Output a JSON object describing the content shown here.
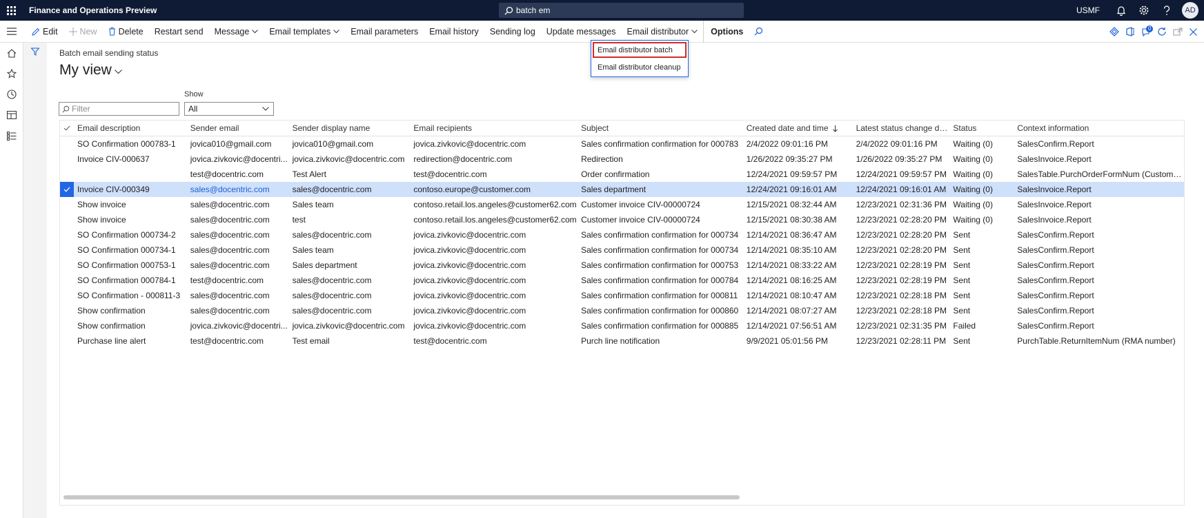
{
  "app": {
    "title": "Finance and Operations Preview",
    "search_value": "batch em",
    "company": "USMF",
    "avatar_initials": "AD"
  },
  "actions": {
    "edit": "Edit",
    "new": "New",
    "delete": "Delete",
    "restart_send": "Restart send",
    "message": "Message",
    "email_templates": "Email templates",
    "email_parameters": "Email parameters",
    "email_history": "Email history",
    "sending_log": "Sending log",
    "update_messages": "Update messages",
    "email_distributor": "Email distributor",
    "options": "Options",
    "notification_count": "0"
  },
  "dropdown": {
    "items": [
      "Email distributor batch",
      "Email distributor cleanup"
    ]
  },
  "page": {
    "caption": "Batch email sending status",
    "view_name": "My view",
    "filter_placeholder": "Filter",
    "show_label": "Show",
    "show_value": "All"
  },
  "grid": {
    "columns": [
      "Email description",
      "Sender email",
      "Sender display name",
      "Email recipients",
      "Subject",
      "Created date and time",
      "Latest status change dat...",
      "Status",
      "Context information"
    ],
    "rows": [
      [
        "SO Confirmation 000783-1",
        "jovica010@gmail.com",
        "jovica010@gmail.com",
        "jovica.zivkovic@docentric.com",
        "Sales confirmation confirmation for 000783",
        "2/4/2022 09:01:16 PM",
        "2/4/2022 09:01:16 PM",
        "Waiting (0)",
        "SalesConfirm.Report"
      ],
      [
        "Invoice CIV-000637",
        "jovica.zivkovic@docentri...",
        "jovica.zivkovic@docentric.com",
        "redirection@docentric.com",
        "Redirection",
        "1/26/2022 09:35:27 PM",
        "1/26/2022 09:35:27 PM",
        "Waiting (0)",
        "SalesInvoice.Report"
      ],
      [
        "",
        "test@docentric.com",
        "Test Alert",
        "test@docentric.com",
        "Order confirmation",
        "12/24/2021 09:59:57 PM",
        "12/24/2021 09:59:57 PM",
        "Waiting (0)",
        "SalesTable.PurchOrderFormNum (Customer r"
      ],
      [
        "Invoice CIV-000349",
        "sales@docentric.com",
        "sales@docentric.com",
        "contoso.europe@customer.com",
        "Sales department",
        "12/24/2021 09:16:01 AM",
        "12/24/2021 09:16:01 AM",
        "Waiting (0)",
        "SalesInvoice.Report"
      ],
      [
        "Show invoice",
        "sales@docentric.com",
        "Sales team",
        "contoso.retail.los.angeles@customer62.com",
        "Customer invoice CIV-00000724",
        "12/15/2021 08:32:44 AM",
        "12/23/2021 02:31:36 PM",
        "Waiting (0)",
        "SalesInvoice.Report"
      ],
      [
        "Show invoice",
        "sales@docentric.com",
        "test",
        "contoso.retail.los.angeles@customer62.com",
        "Customer invoice CIV-00000724",
        "12/15/2021 08:30:38 AM",
        "12/23/2021 02:28:20 PM",
        "Waiting (0)",
        "SalesInvoice.Report"
      ],
      [
        "SO Confirmation 000734-2",
        "sales@docentric.com",
        "sales@docentric.com",
        "jovica.zivkovic@docentric.com",
        "Sales confirmation confirmation for 000734",
        "12/14/2021 08:36:47 AM",
        "12/23/2021 02:28:20 PM",
        "Sent",
        "SalesConfirm.Report"
      ],
      [
        "SO Confirmation 000734-1",
        "sales@docentric.com",
        "Sales team",
        "jovica.zivkovic@docentric.com",
        "Sales confirmation confirmation for 000734",
        "12/14/2021 08:35:10 AM",
        "12/23/2021 02:28:20 PM",
        "Sent",
        "SalesConfirm.Report"
      ],
      [
        "SO Confirmation 000753-1",
        "sales@docentric.com",
        "Sales department",
        "jovica.zivkovic@docentric.com",
        "Sales confirmation confirmation for 000753",
        "12/14/2021 08:33:22 AM",
        "12/23/2021 02:28:19 PM",
        "Sent",
        "SalesConfirm.Report"
      ],
      [
        "SO Confirmation 000784-1",
        "test@docentric.com",
        "sales@docentric.com",
        "jovica.zivkovic@docentric.com",
        "Sales confirmation confirmation for 000784",
        "12/14/2021 08:16:25 AM",
        "12/23/2021 02:28:19 PM",
        "Sent",
        "SalesConfirm.Report"
      ],
      [
        "SO Confirmation - 000811-3",
        "sales@docentric.com",
        "sales@docentric.com",
        "jovica.zivkovic@docentric.com",
        "Sales confirmation confirmation for 000811",
        "12/14/2021 08:10:47 AM",
        "12/23/2021 02:28:18 PM",
        "Sent",
        "SalesConfirm.Report"
      ],
      [
        "Show confirmation",
        "sales@docentric.com",
        "sales@docentric.com",
        "jovica.zivkovic@docentric.com",
        "Sales confirmation confirmation for 000860",
        "12/14/2021 08:07:27 AM",
        "12/23/2021 02:28:18 PM",
        "Sent",
        "SalesConfirm.Report"
      ],
      [
        "Show confirmation",
        "jovica.zivkovic@docentri...",
        "jovica.zivkovic@docentric.com",
        "jovica.zivkovic@docentric.com",
        "Sales confirmation confirmation for 000885",
        "12/14/2021 07:56:51 AM",
        "12/23/2021 02:31:35 PM",
        "Failed",
        "SalesConfirm.Report"
      ],
      [
        "Purchase line alert",
        "test@docentric.com",
        "Test email",
        "test@docentric.com",
        "Purch line notification",
        "9/9/2021 05:01:56 PM",
        "12/23/2021 02:28:11 PM",
        "Sent",
        "PurchTable.ReturnItemNum (RMA number)"
      ]
    ],
    "selected_row": 3
  },
  "colors": {
    "topbar": "#0f1b35",
    "accent": "#2266e3",
    "selected_row": "#cfe0fa",
    "menu_highlight": "#d12a2a"
  }
}
